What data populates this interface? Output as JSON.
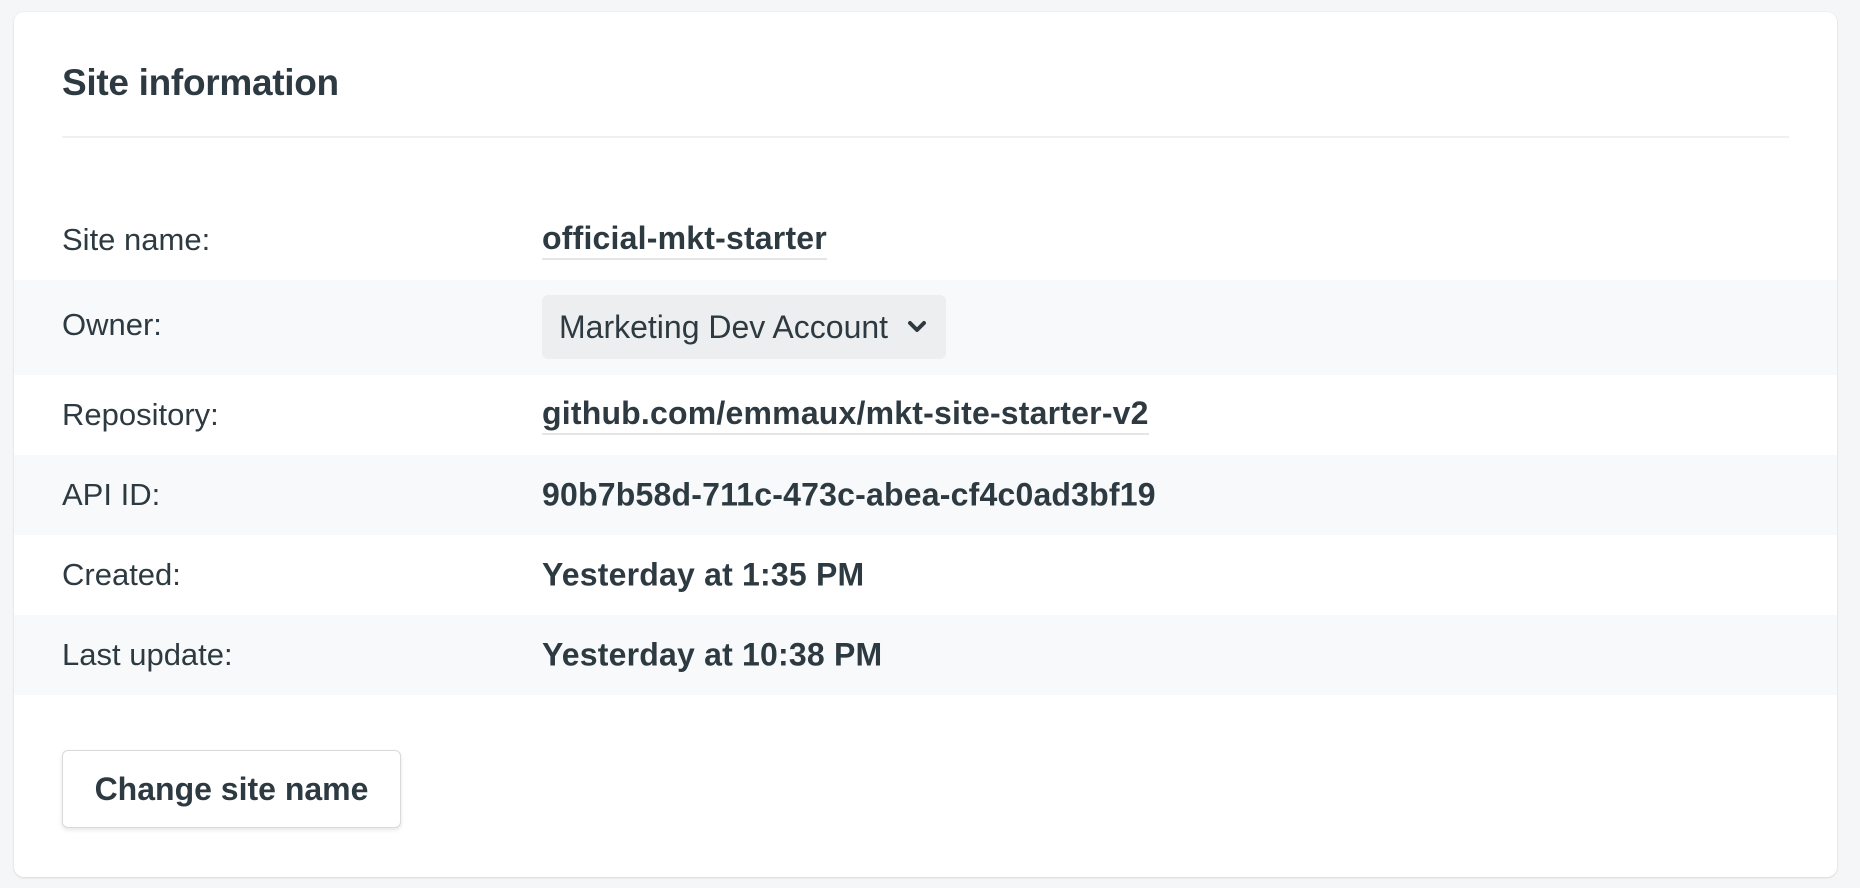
{
  "card": {
    "title": "Site information"
  },
  "fields": {
    "site_name": {
      "label": "Site name:",
      "value": "official-mkt-starter"
    },
    "owner": {
      "label": "Owner:",
      "value": "Marketing Dev Account",
      "icon": "chevron-down-icon"
    },
    "repository": {
      "label": "Repository:",
      "value": "github.com/emmaux/mkt-site-starter-v2"
    },
    "api_id": {
      "label": "API ID:",
      "value": "90b7b58d-711c-473c-abea-cf4c0ad3bf19"
    },
    "created": {
      "label": "Created:",
      "value": "Yesterday at 1:35 PM"
    },
    "last_update": {
      "label": "Last update:",
      "value": "Yesterday at 10:38 PM"
    }
  },
  "actions": {
    "change_site_name": "Change site name"
  },
  "colors": {
    "background": "#f4f6f7",
    "card": "#ffffff",
    "text": "#2e3a41",
    "row_alt": "#f7f9fa",
    "select_bg": "#eceeef"
  }
}
